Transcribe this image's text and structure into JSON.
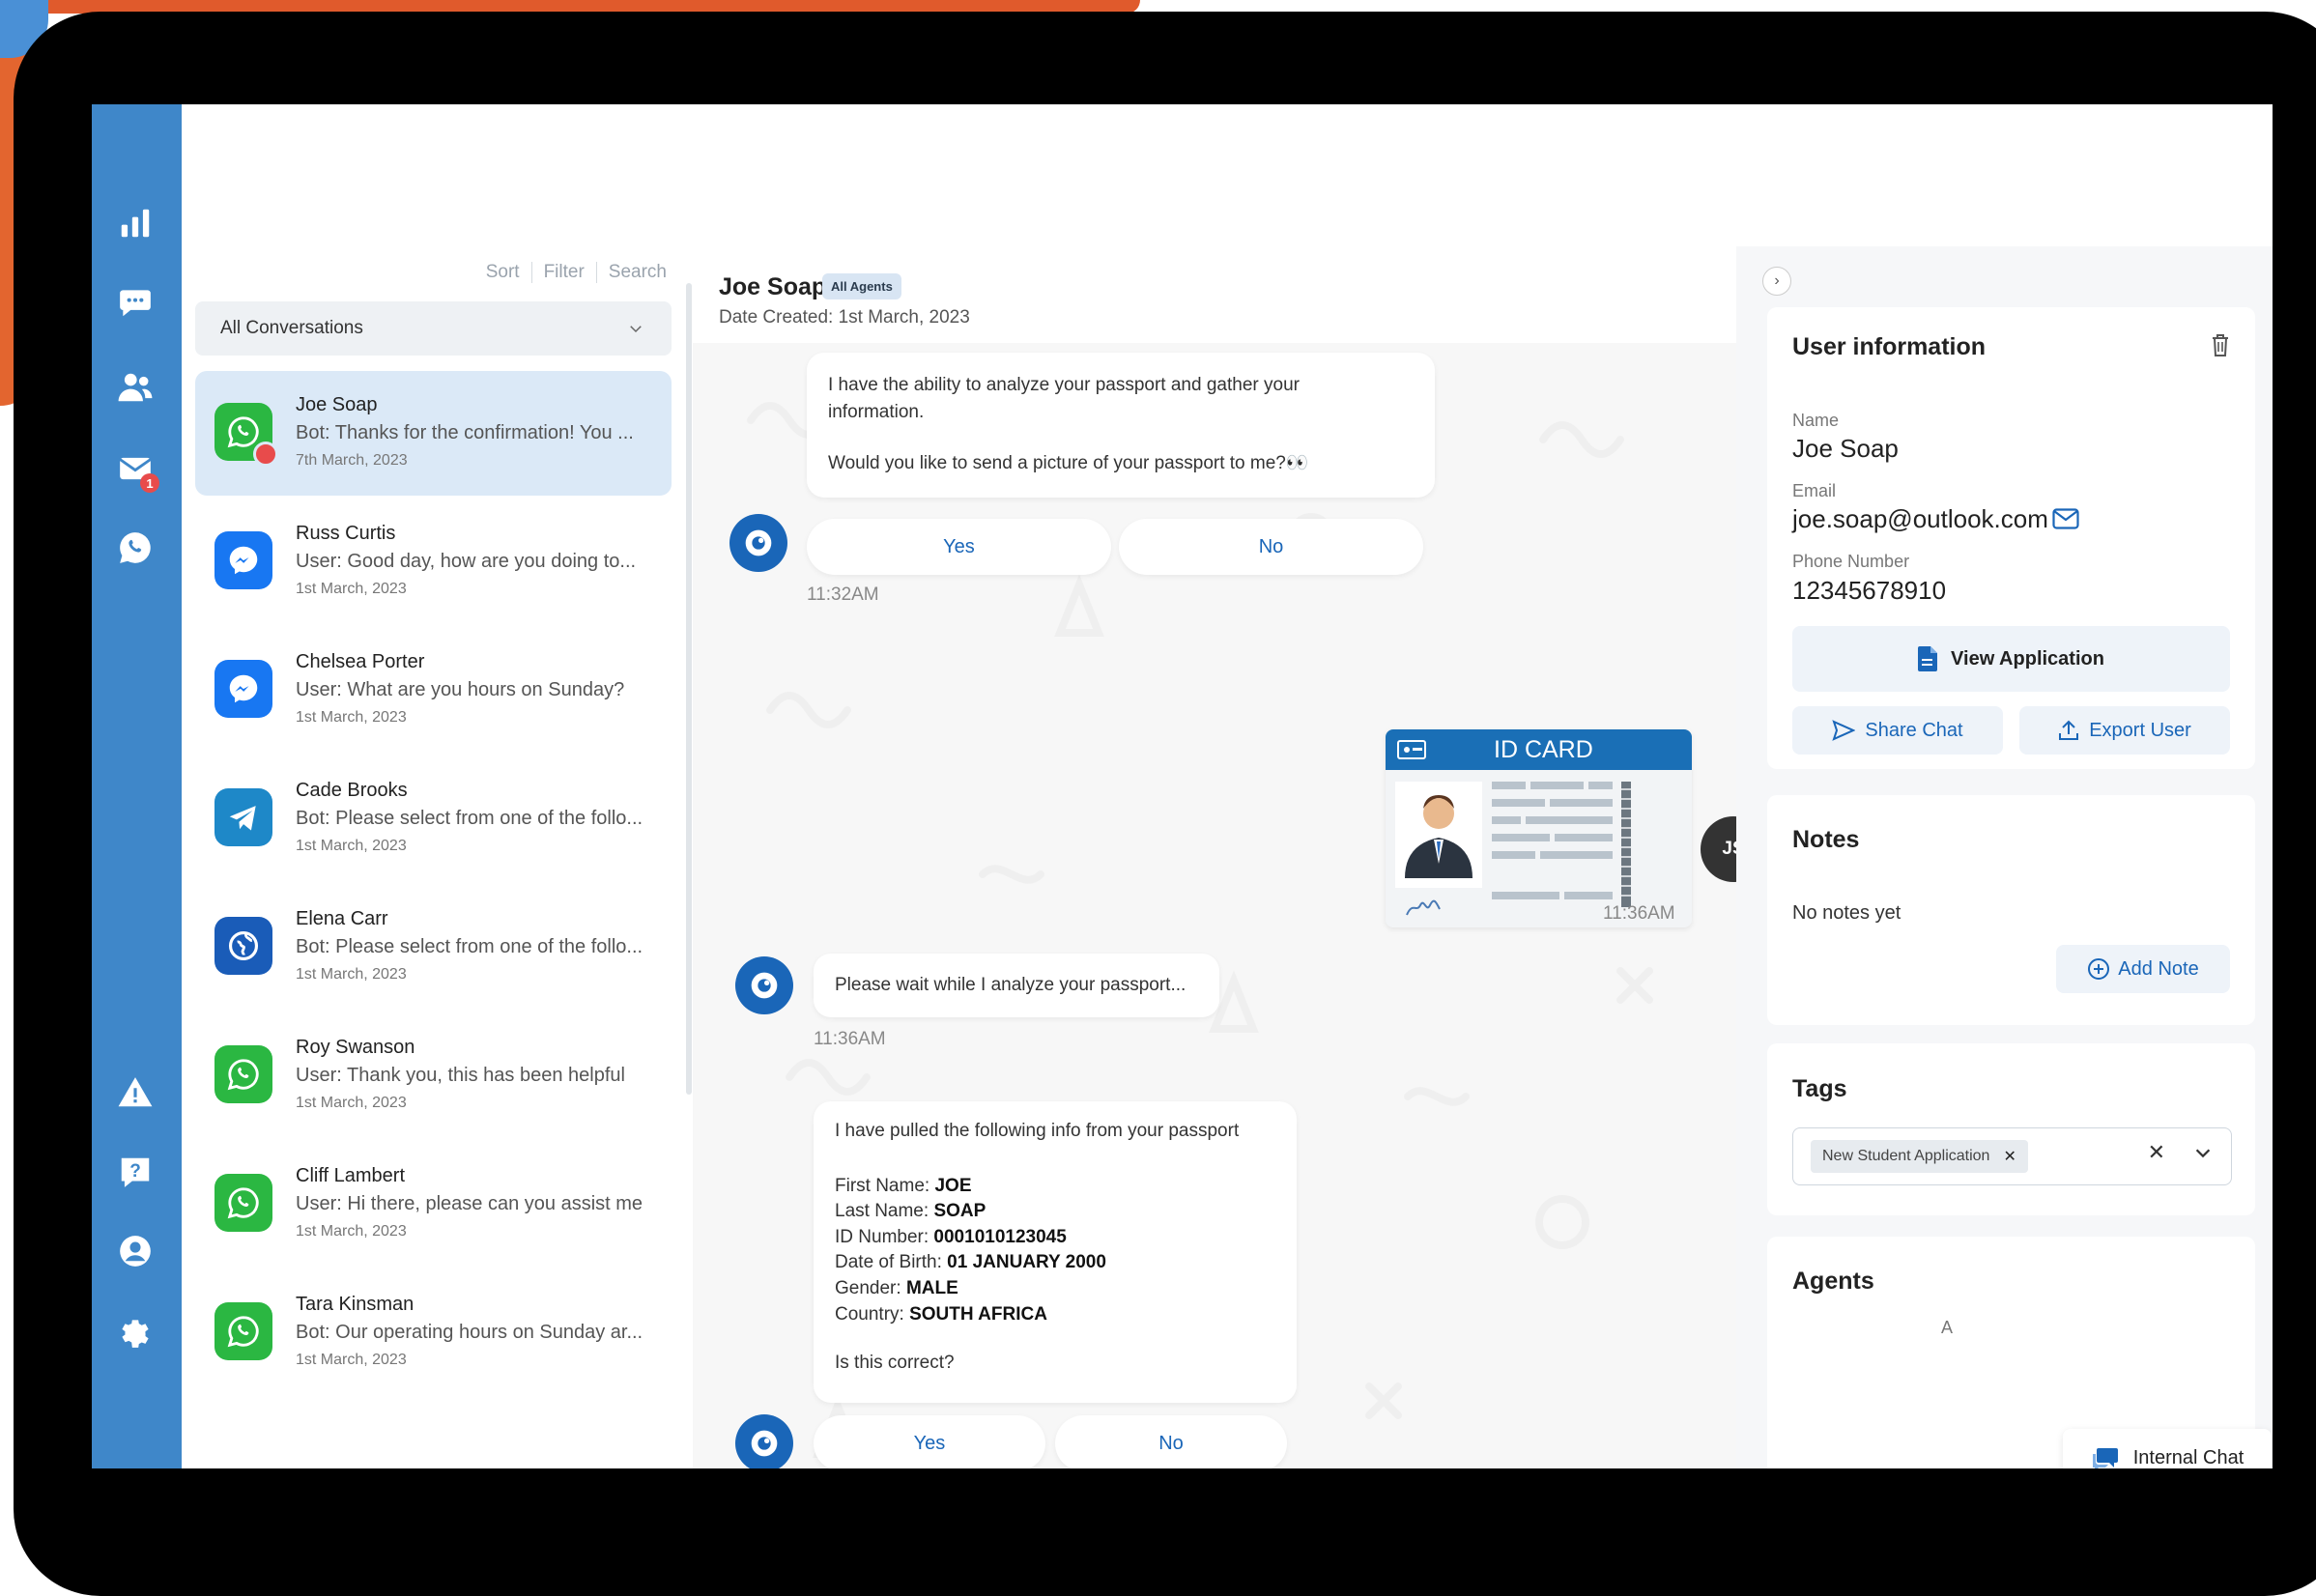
{
  "colors": {
    "nav_bg": "#3f87c9",
    "accent": "#1a66b8",
    "active_conv": "#dbe9f7",
    "whatsapp": "#2bb742",
    "messenger": "#1877f2",
    "telegram": "#1e88c8",
    "web": "#1a5cb8",
    "alert_red": "#e84b4b"
  },
  "nav": {
    "items": [
      {
        "icon": "bar-chart-icon"
      },
      {
        "icon": "chat-bubble-icon"
      },
      {
        "icon": "users-icon"
      },
      {
        "icon": "envelope-icon",
        "badge": "1"
      },
      {
        "icon": "whatsapp-icon"
      },
      {
        "icon": "warning-icon"
      },
      {
        "icon": "help-icon"
      },
      {
        "icon": "user-circle-icon"
      },
      {
        "icon": "gear-icon"
      }
    ]
  },
  "list": {
    "tools": [
      "Sort",
      "Filter",
      "Search"
    ],
    "filter_value": "All Conversations",
    "conversations": [
      {
        "name": "Joe Soap",
        "message": "Bot: Thanks for the confirmation! You ...",
        "date": "7th March, 2023",
        "channel": "whatsapp",
        "active": true
      },
      {
        "name": "Russ Curtis",
        "message": "User: Good day, how are you doing to...",
        "date": "1st March, 2023",
        "channel": "messenger"
      },
      {
        "name": "Chelsea Porter",
        "message": "User: What are you hours on Sunday?",
        "date": "1st March, 2023",
        "channel": "messenger"
      },
      {
        "name": "Cade Brooks",
        "message": "Bot: Please select from one of the follo...",
        "date": "1st March, 2023",
        "channel": "telegram"
      },
      {
        "name": "Elena Carr",
        "message": "Bot: Please select from one of the follo...",
        "date": "1st March, 2023",
        "channel": "web"
      },
      {
        "name": "Roy Swanson",
        "message": "User: Thank you, this has been helpful",
        "date": "1st March, 2023",
        "channel": "whatsapp"
      },
      {
        "name": "Cliff Lambert",
        "message": "User: Hi there, please can you assist me",
        "date": "1st March, 2023",
        "channel": "whatsapp"
      },
      {
        "name": "Tara Kinsman",
        "message": "Bot: Our operating hours on Sunday ar...",
        "date": "1st March, 2023",
        "channel": "whatsapp"
      }
    ]
  },
  "chat": {
    "title": "Joe Soap",
    "chip": "All Agents",
    "date_created": "Date Created: 1st March, 2023",
    "msg1_line1": "I have the ability to analyze your passport and gather your information.",
    "msg1_line2": "Would you like to send a picture of your passport to me?👀",
    "yes": "Yes",
    "no": "No",
    "time1": "11:32AM",
    "id_card_label": "ID CARD",
    "user_initials": "JS",
    "time2": "11:36AM",
    "msg2": "Please wait while I analyze your passport...",
    "time3": "11:36AM",
    "msg3_intro": "I have pulled the following info from your passport",
    "fields": [
      {
        "label": "First Name:",
        "value": "JOE"
      },
      {
        "label": "Last Name:",
        "value": "SOAP"
      },
      {
        "label": "ID Number:",
        "value": "0001010123045"
      },
      {
        "label": "Date of Birth:",
        "value": "01 JANUARY 2000"
      },
      {
        "label": "Gender:",
        "value": "MALE"
      },
      {
        "label": "Country:",
        "value": "SOUTH AFRICA"
      }
    ],
    "msg3_question": "Is this correct?"
  },
  "user_info": {
    "title": "User information",
    "name_label": "Name",
    "name": "Joe Soap",
    "email_label": "Email",
    "email": "joe.soap@outlook.com",
    "phone_label": "Phone Number",
    "phone": "12345678910",
    "view_application": "View Application",
    "share_chat": "Share Chat",
    "export_user": "Export User"
  },
  "notes": {
    "title": "Notes",
    "empty": "No notes yet",
    "add": "Add Note"
  },
  "tags": {
    "title": "Tags",
    "items": [
      "New Student Application"
    ]
  },
  "agents": {
    "title": "Agents",
    "partial": "A"
  },
  "internal_chat": "Internal Chat"
}
